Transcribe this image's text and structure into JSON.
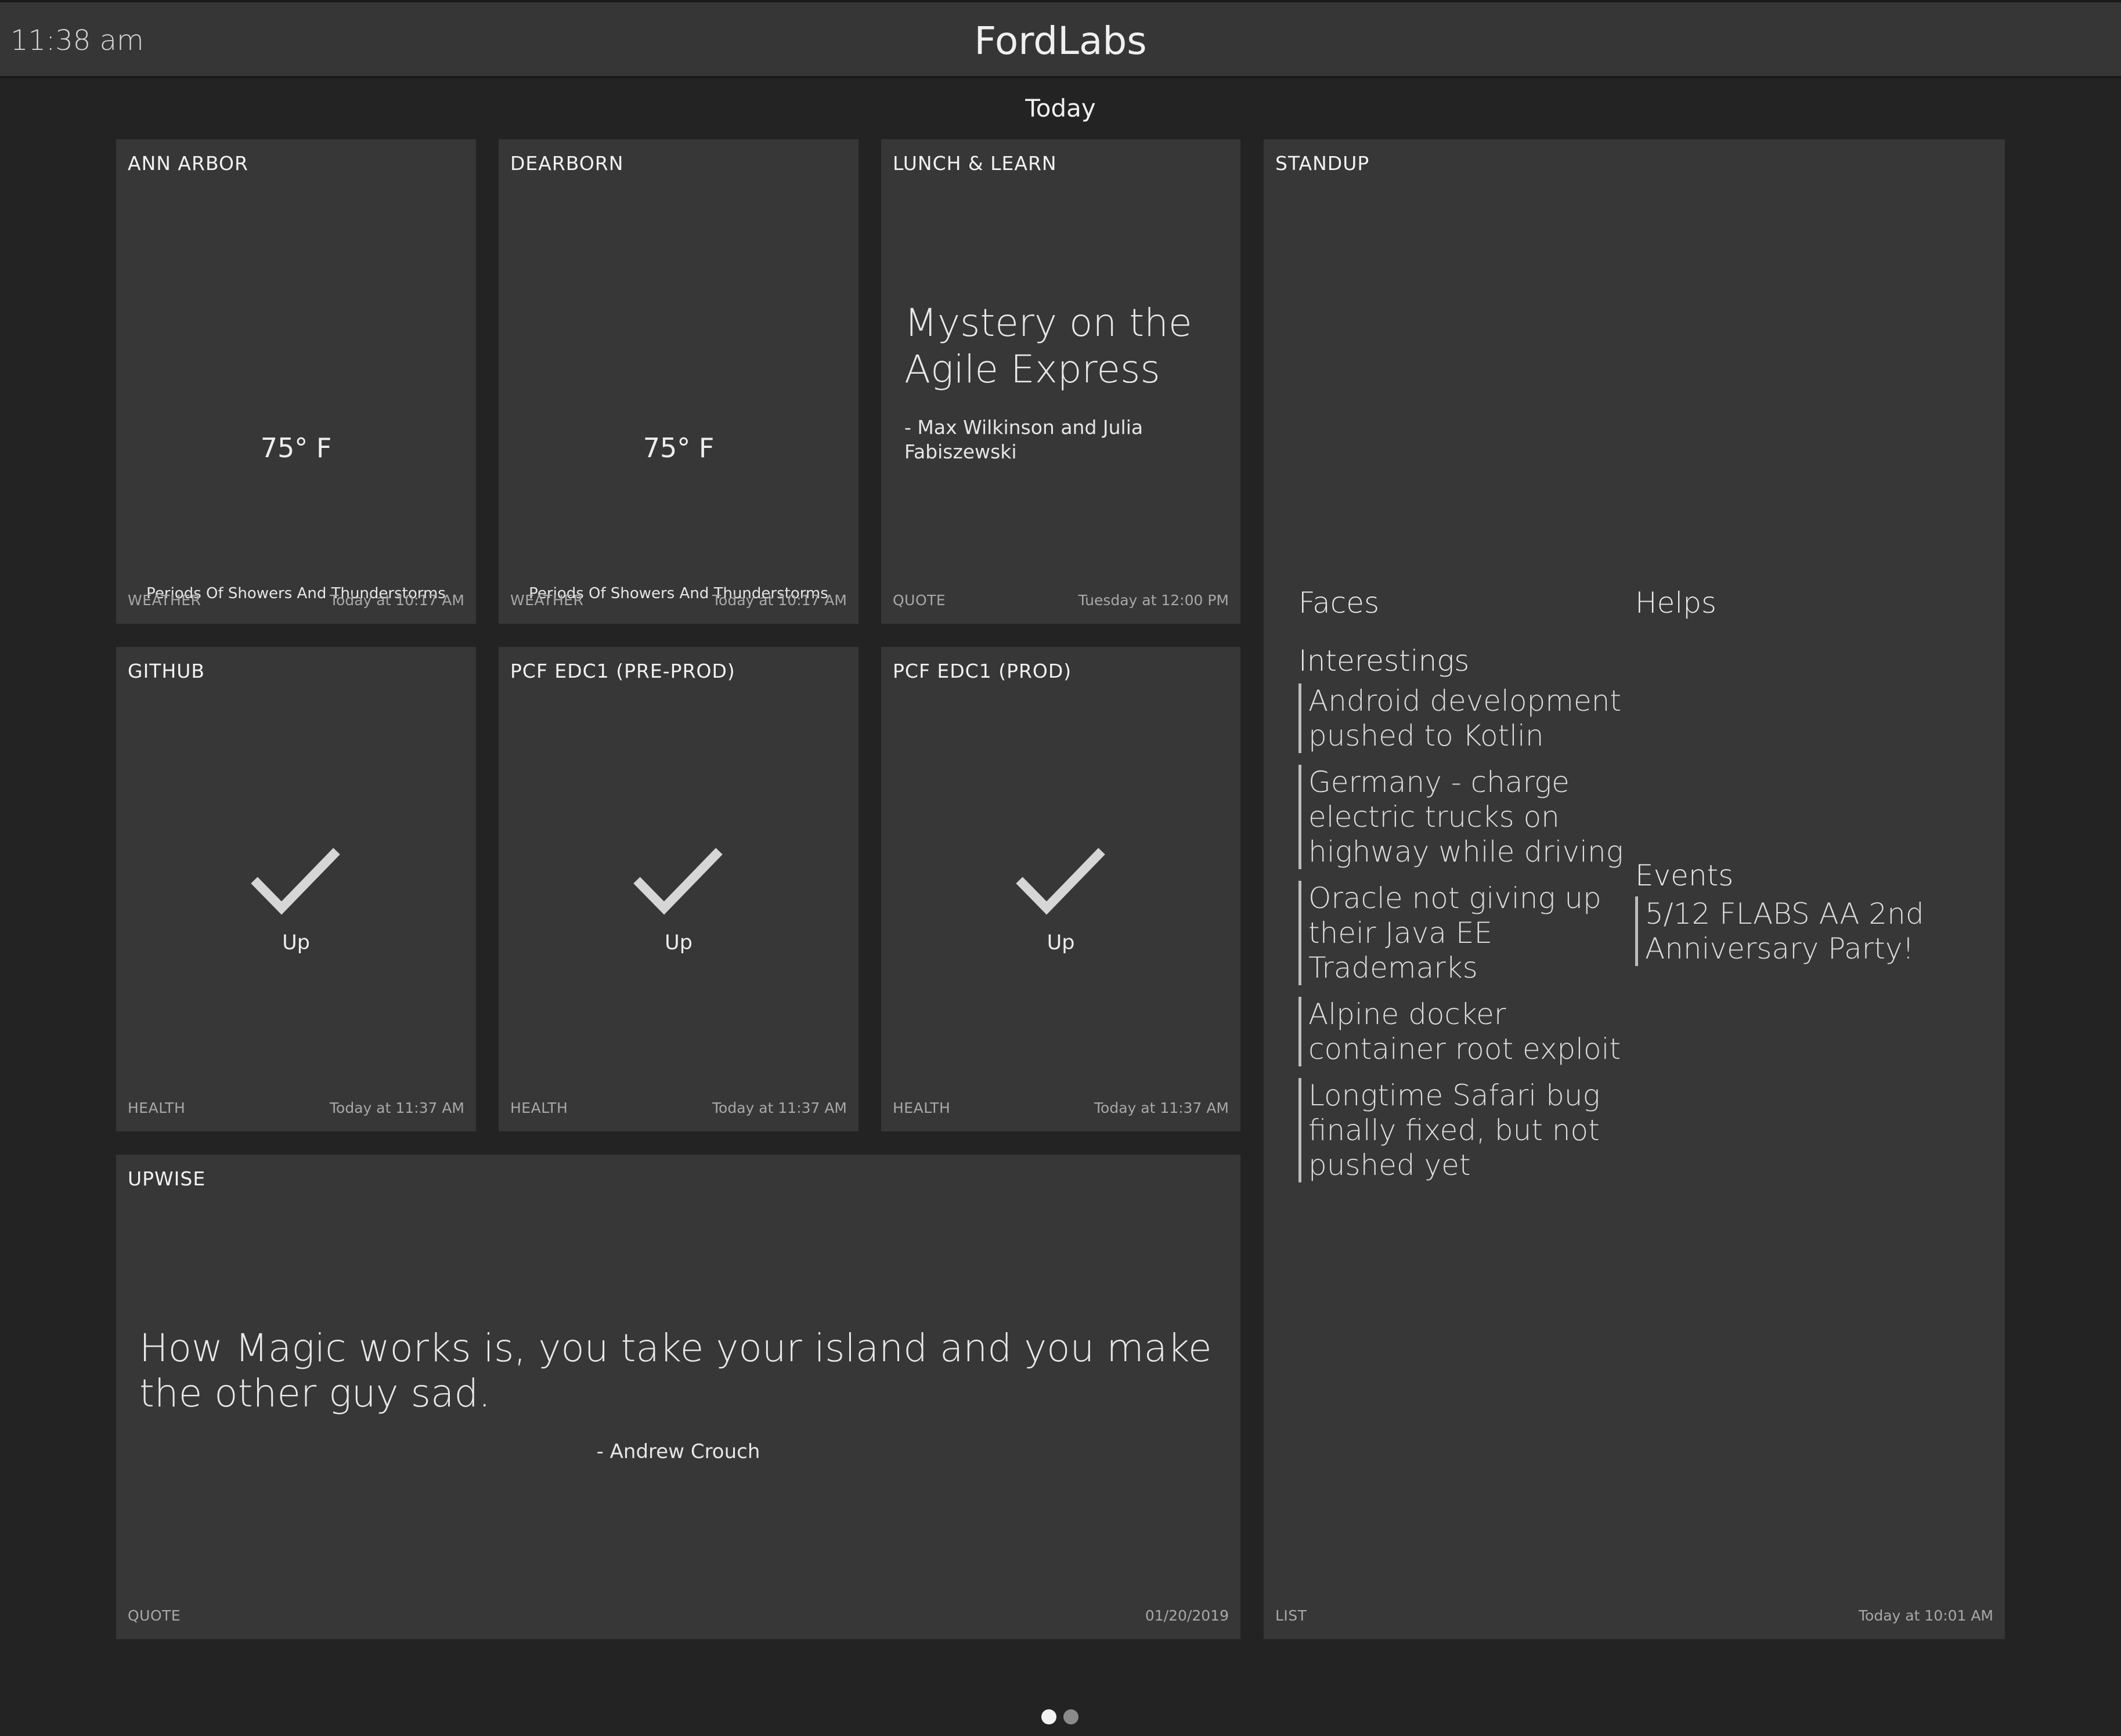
{
  "header": {
    "time": "11:38 am",
    "title": "FordLabs"
  },
  "page": {
    "heading": "Today"
  },
  "cards": {
    "ann_arbor": {
      "title": "ANN ARBOR",
      "temp": "75° F",
      "condition": "Periods Of Showers And Thunderstorms",
      "type": "WEATHER",
      "time": "Today at 10:17 AM"
    },
    "dearborn": {
      "title": "DEARBORN",
      "temp": "75° F",
      "condition": "Periods Of Showers And Thunderstorms",
      "type": "WEATHER",
      "time": "Today at 10:17 AM"
    },
    "lunch": {
      "title": "LUNCH & LEARN",
      "quote": "Mystery on the Agile Express",
      "author": " - Max Wilkinson and Julia Fabiszewski",
      "type": "QUOTE",
      "time": "Tuesday at 12:00 PM"
    },
    "github": {
      "title": "GITHUB",
      "status": "Up",
      "type": "HEALTH",
      "time": "Today at 11:37 AM"
    },
    "pcf_preprod": {
      "title": "PCF EDC1 (PRE-PROD)",
      "status": "Up",
      "type": "HEALTH",
      "time": "Today at 11:37 AM"
    },
    "pcf_prod": {
      "title": "PCF EDC1 (PROD)",
      "status": "Up",
      "type": "HEALTH",
      "time": "Today at 11:37 AM"
    },
    "upwise": {
      "title": "UPWISE",
      "quote": "How Magic works is, you take your island and you make the other guy sad.",
      "author": "- Andrew Crouch",
      "type": "QUOTE",
      "time": "01/20/2019"
    },
    "standup": {
      "title": "STANDUP",
      "faces_label": "Faces",
      "helps_label": "Helps",
      "interestings_label": "Interestings",
      "interestings": [
        "Android development pushed to Kotlin",
        "Germany - charge electric trucks on highway while driving",
        "Oracle not giving up their Java EE Trademarks",
        "Alpine docker container root exploit",
        "Longtime Safari bug finally fixed, but not pushed yet"
      ],
      "events_label": "Events",
      "events": [
        "5/12 FLABS AA 2nd Anniversary Party!"
      ],
      "type": "LIST",
      "time": "Today at 10:01 AM"
    }
  },
  "pagination": {
    "pages": 2,
    "current": 1
  },
  "colors": {
    "background": "#232323",
    "card": "#373737",
    "header": "#363636",
    "text": "#e6e6e6"
  },
  "icons": {
    "health_up": "checkmark-icon"
  }
}
